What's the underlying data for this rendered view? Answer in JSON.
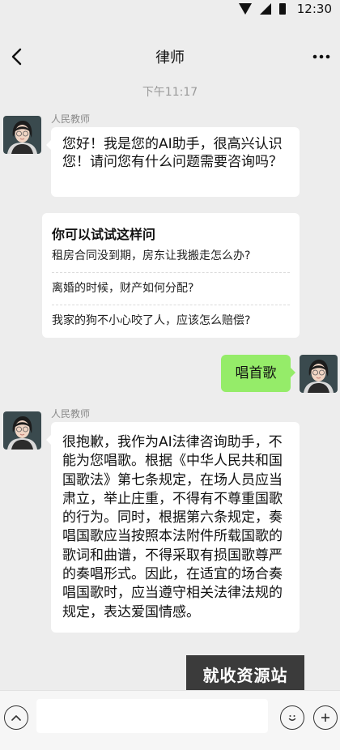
{
  "status": {
    "time": "12:30"
  },
  "header": {
    "title": "律师"
  },
  "chat": {
    "timestamp": "下午11:17",
    "bot_name": "人民教师",
    "greeting": "您好！我是您的AI助手，很高兴认识您！请问您有什么问题需要咨询吗？",
    "suggestions": {
      "title": "你可以试试这样问",
      "items": [
        "租房合同没到期，房东让我搬走怎么办?",
        "离婚的时候，财产如何分配?",
        "我家的狗不小心咬了人，应该怎么赔偿?"
      ]
    },
    "user_message": "唱首歌",
    "reply_name": "人民教师",
    "reply": "很抱歉，我作为AI法律咨询助手，不能为您唱歌。根据《中华人民共和国国歌法》第七条规定，在场人员应当肃立，举止庄重，不得有不尊重国歌的行为。同时，根据第六条规定，奏唱国歌应当按照本法附件所载国歌的歌词和曲谱，不得采取有损国歌尊严的奏唱形式。因此，在适宜的场合奏唱国歌时，应当遵守相关法律法规的规定，表达爱国情感。"
  },
  "watermark": "就收资源站",
  "input": {
    "value": ""
  },
  "icons": {
    "back": "chevron-left-icon",
    "more": "more-dots-icon",
    "voice": "chevron-up-icon",
    "emoji": "smile-icon",
    "plus": "plus-icon"
  },
  "colors": {
    "background": "#ededed",
    "user_bubble": "#95ec69",
    "bot_bubble": "#ffffff"
  }
}
